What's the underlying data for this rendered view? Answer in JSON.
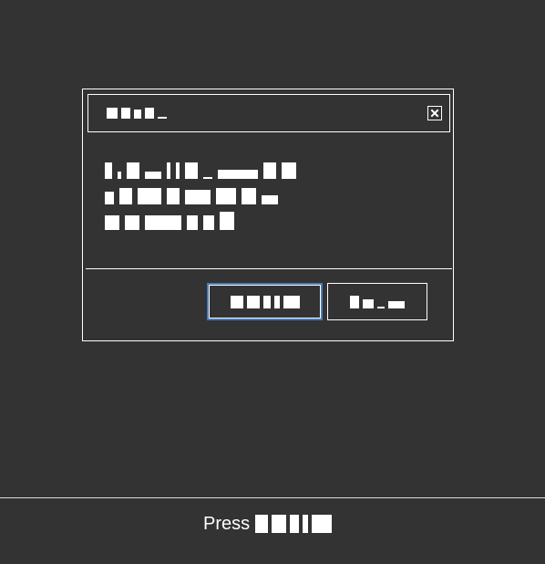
{
  "dialog": {
    "title": "",
    "body_lines": [
      "",
      "",
      ""
    ],
    "primary_button_label": "",
    "secondary_button_label": ""
  },
  "footer": {
    "prefix": "Press",
    "key_label": ""
  },
  "colors": {
    "background": "#333333",
    "foreground": "#ffffff",
    "focus_ring": "#4a7cb8"
  },
  "icons": {
    "close": "close-icon"
  }
}
